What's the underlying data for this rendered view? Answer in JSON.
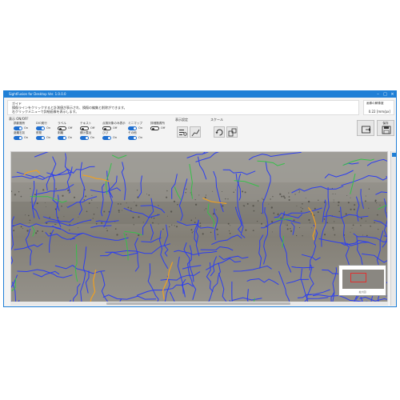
{
  "window": {
    "title": "SightFusion for Desktop Ver. 1.0.0.0"
  },
  "guide": {
    "heading": "ガイド",
    "lines": [
      "損傷ラインをクリックすると計測値が表示され、損傷の編集と削除ができます。",
      "右クリックメニューで詳細画像を表示します。"
    ]
  },
  "resolution": {
    "label": "画像の解像度",
    "value": "0.22 [mm/px]"
  },
  "display": {
    "title": "表示 ON/OFF",
    "toggles": [
      {
        "label": "損影箇所",
        "state": "On",
        "on": true
      },
      {
        "label": "DIO実行",
        "state": "On",
        "on": true
      },
      {
        "label": "ラベル",
        "state": "Off",
        "on": false
      },
      {
        "label": "テキスト",
        "state": "Off",
        "on": false
      },
      {
        "label": "点検対象のみ表示",
        "state": "Off",
        "on": false
      },
      {
        "label": "ミニマップ",
        "state": "On",
        "on": true
      },
      {
        "label": "詳細箇書所",
        "state": "Off",
        "on": false
      },
      {
        "label": "遊離石灰",
        "state": "On",
        "on": true
      },
      {
        "label": "鉄筋",
        "state": "On",
        "on": true
      },
      {
        "label": "剥離",
        "state": "On",
        "on": true
      },
      {
        "label": "錆汁露出",
        "state": "On",
        "on": true
      },
      {
        "label": "ひび",
        "state": "On",
        "on": true
      },
      {
        "label": "その他",
        "state": "On",
        "on": true
      }
    ]
  },
  "display_settings": {
    "title": "表示設定"
  },
  "scale": {
    "title": "スケール"
  },
  "actions": {
    "export_label": "",
    "save_label": "保存"
  },
  "minimap": {
    "caption": "拡大図"
  },
  "colors": {
    "accent": "#1f7fd6",
    "crack": "#2c3ef0",
    "efflorescence": "#36c04a",
    "rust": "#f0a020"
  }
}
